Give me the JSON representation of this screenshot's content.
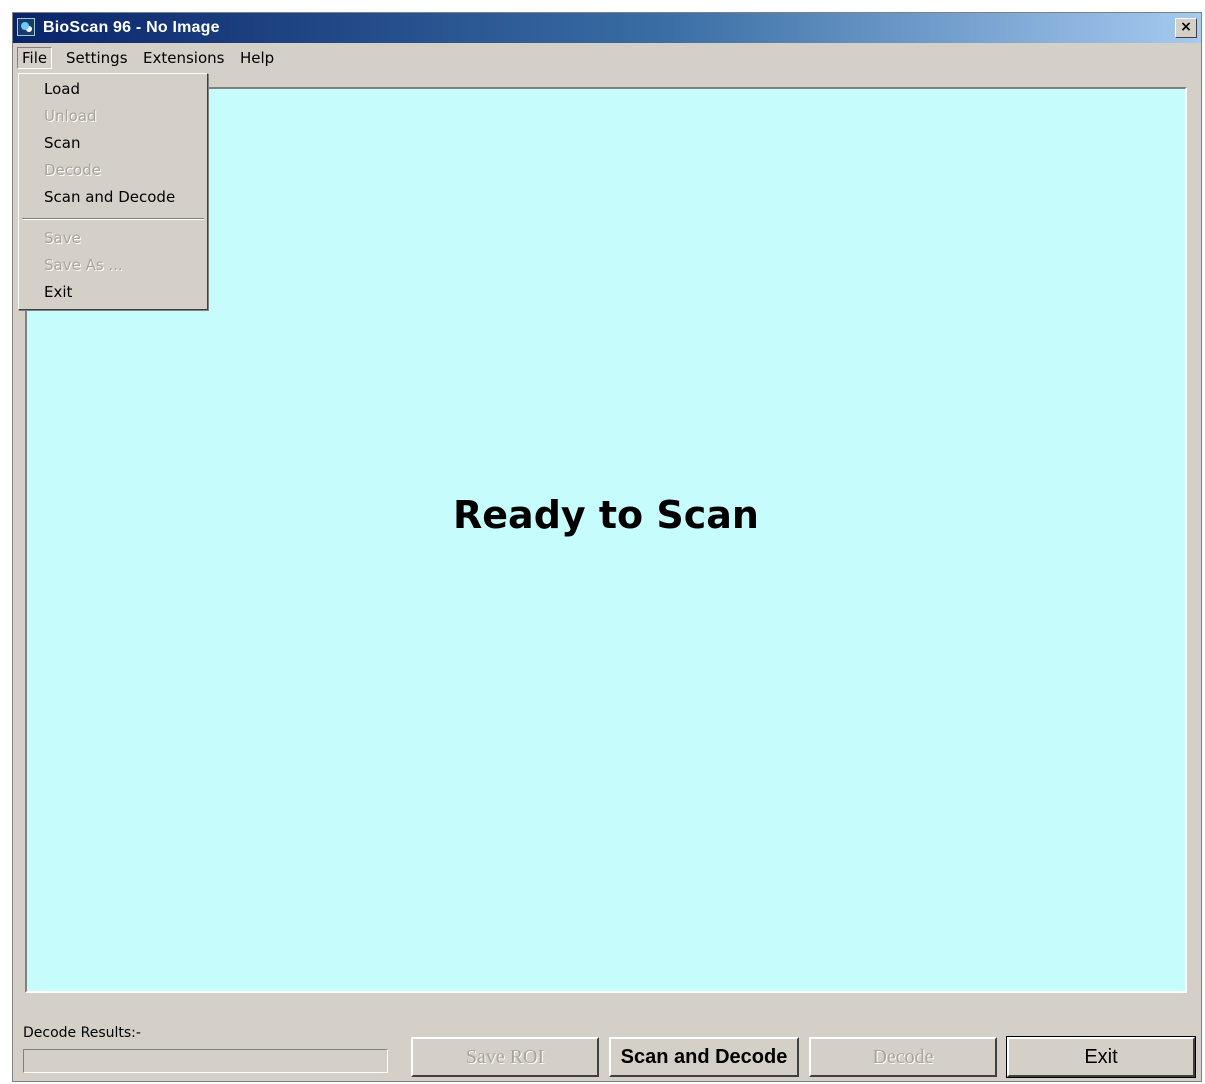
{
  "window": {
    "title": "BioScan 96 - No Image",
    "close_label": "×"
  },
  "menubar": {
    "items": [
      {
        "label": "File"
      },
      {
        "label": "Settings"
      },
      {
        "label": "Extensions"
      },
      {
        "label": "Help"
      }
    ]
  },
  "file_menu": {
    "items": [
      {
        "label": "Load",
        "enabled": true
      },
      {
        "label": "Unload",
        "enabled": false
      },
      {
        "label": "Scan",
        "enabled": true
      },
      {
        "label": "Decode",
        "enabled": false
      },
      {
        "label": "Scan and Decode",
        "enabled": true
      },
      {
        "label": "Save",
        "enabled": false
      },
      {
        "label": "Save As ...",
        "enabled": false
      },
      {
        "label": "Exit",
        "enabled": true
      }
    ]
  },
  "canvas": {
    "message": "Ready to Scan",
    "background": "#c6fcfc"
  },
  "results": {
    "label": "Decode Results:-",
    "value": ""
  },
  "buttons": {
    "save_roi": "Save ROI",
    "scan_and_decode": "Scan and Decode",
    "decode": "Decode",
    "exit": "Exit"
  }
}
